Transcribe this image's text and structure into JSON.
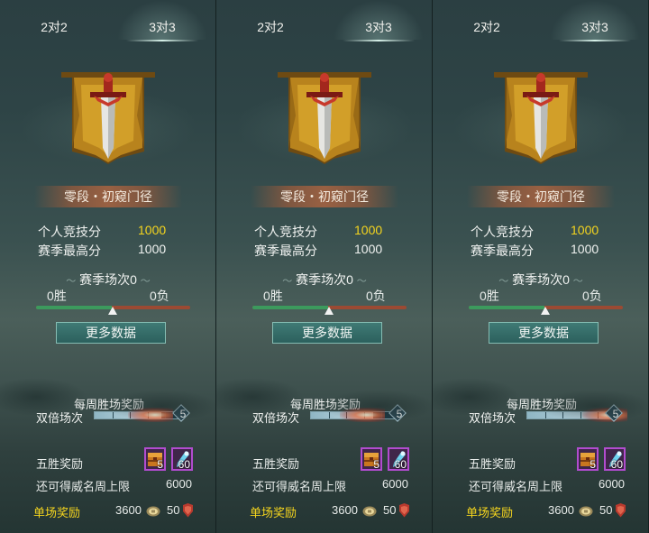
{
  "panels": [
    {
      "tabs": [
        "2对2",
        "3对3"
      ],
      "active_tab": 1,
      "rank_name": "零段・初窥门径",
      "personal_score_label": "个人竞技分",
      "personal_score": "1000",
      "season_high_label": "赛季最高分",
      "season_high": "1000",
      "season_matches": "赛季场次0",
      "wins": "0胜",
      "losses": "0负",
      "more_data_button": "更多数据",
      "weekly_reward_title": "每周胜场奖励",
      "double_label": "双倍场次",
      "double_count": "5",
      "double_progress": 0.75,
      "five_win_label": "五胜奖励",
      "item1_count": "5",
      "item2_count": "60",
      "weekly_cap_label": "还可得威名周上限",
      "weekly_cap_value": "6000",
      "single_reward_label": "单场奖励",
      "single_reward_coin": "3600",
      "single_reward_honor": "50"
    },
    {
      "tabs": [
        "2对2",
        "3对3"
      ],
      "active_tab": 1,
      "rank_name": "零段・初窥门径",
      "personal_score_label": "个人竞技分",
      "personal_score": "1000",
      "season_high_label": "赛季最高分",
      "season_high": "1000",
      "season_matches": "赛季场次0",
      "wins": "0胜",
      "losses": "0负",
      "more_data_button": "更多数据",
      "weekly_reward_title": "每周胜场奖励",
      "double_label": "双倍场次",
      "double_count": "5",
      "double_progress": 0.7,
      "five_win_label": "五胜奖励",
      "item1_count": "5",
      "item2_count": "60",
      "weekly_cap_label": "还可得威名周上限",
      "weekly_cap_value": "6000",
      "single_reward_label": "单场奖励",
      "single_reward_coin": "3600",
      "single_reward_honor": "50"
    },
    {
      "tabs": [
        "2对2",
        "3对3"
      ],
      "active_tab": 1,
      "rank_name": "零段・初窥门径",
      "personal_score_label": "个人竞技分",
      "personal_score": "1000",
      "season_high_label": "赛季最高分",
      "season_high": "1000",
      "season_matches": "赛季场次0",
      "wins": "0胜",
      "losses": "0负",
      "more_data_button": "更多数据",
      "weekly_reward_title": "每周胜场奖励",
      "double_label": "双倍场次",
      "double_count": "5",
      "double_progress": 1.0,
      "five_win_label": "五胜奖励",
      "item1_count": "5",
      "item2_count": "60",
      "weekly_cap_label": "还可得威名周上限",
      "weekly_cap_value": "6000",
      "single_reward_label": "单场奖励",
      "single_reward_coin": "3600",
      "single_reward_honor": "50"
    }
  ],
  "icons": {
    "emblem": "sword-banner-icon",
    "coin": "coin-icon",
    "honor": "shield-icon",
    "item1": "treasure-chest-icon",
    "item2": "blue-pendant-icon"
  },
  "colors": {
    "highlight_gold": "#f5d51e",
    "win_bar": "#3c9a5d",
    "loss_bar": "#9b4a33",
    "button_border": "#86bdb3",
    "item_border": "#b24ccf"
  }
}
